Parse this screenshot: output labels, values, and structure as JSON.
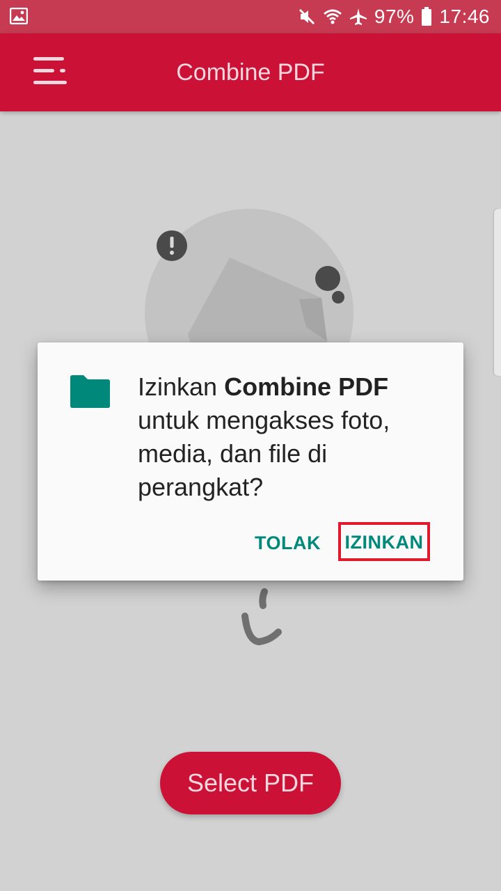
{
  "status_bar": {
    "battery_percent": "97%",
    "time": "17:46",
    "icons": [
      "image-icon",
      "mute-icon",
      "wifi-icon",
      "airplane-icon",
      "battery-icon"
    ]
  },
  "app_bar": {
    "title": "Combine PDF",
    "menu_icon": "menu-icon"
  },
  "dialog": {
    "icon": "folder-icon",
    "message_prefix": "Izinkan ",
    "app_name": "Combine PDF",
    "message_suffix": " untuk mengakses foto, media, dan file di perangkat?",
    "deny_label": "TOLAK",
    "allow_label": "IZINKAN"
  },
  "main": {
    "select_button_label": "Select PDF"
  },
  "colors": {
    "status_bar": "#c73b52",
    "app_bar": "#cb1136",
    "accent": "#00897b",
    "highlight": "#e0192c",
    "scrim_background": "#d2d2d2"
  }
}
